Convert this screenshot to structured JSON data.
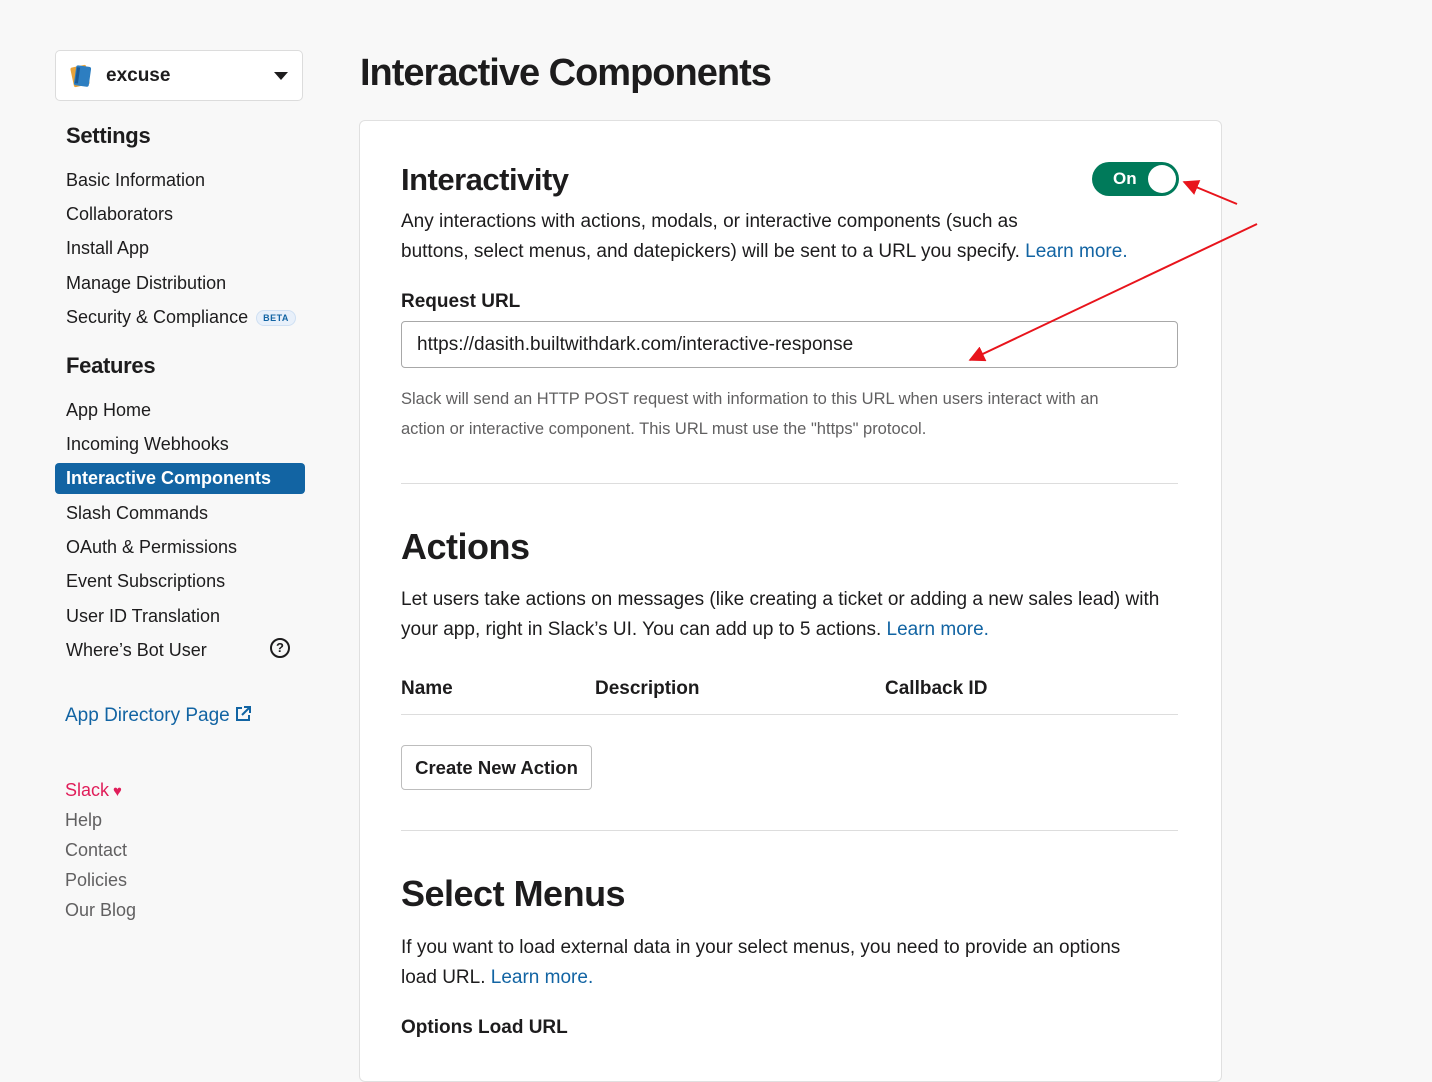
{
  "app": {
    "name": "excuse"
  },
  "sidebar": {
    "settings_heading": "Settings",
    "settings_items": [
      {
        "label": "Basic Information"
      },
      {
        "label": "Collaborators"
      },
      {
        "label": "Install App"
      },
      {
        "label": "Manage Distribution"
      },
      {
        "label": "Security & Compliance",
        "badge": "BETA"
      }
    ],
    "features_heading": "Features",
    "features_items": [
      {
        "label": "App Home"
      },
      {
        "label": "Incoming Webhooks"
      },
      {
        "label": "Interactive Components",
        "active": true
      },
      {
        "label": "Slash Commands"
      },
      {
        "label": "OAuth & Permissions"
      },
      {
        "label": "Event Subscriptions"
      },
      {
        "label": "User ID Translation"
      },
      {
        "label": "Where’s Bot User"
      }
    ],
    "help_glyph": "?",
    "app_directory_link": "App Directory Page",
    "footer": {
      "slack": "Slack",
      "heart": "♥",
      "help": "Help",
      "contact": "Contact",
      "policies": "Policies",
      "blog": "Our Blog"
    }
  },
  "main": {
    "title": "Interactive Components",
    "interactivity": {
      "title": "Interactivity",
      "toggle_label": "On",
      "toggle_on": true,
      "description_line1": "Any interactions with actions, modals, or interactive components (such as",
      "description_line2": "buttons, select menus, and datepickers) will be sent to a URL you specify.",
      "learn_more": "Learn more.",
      "request_url_label": "Request URL",
      "request_url_value": "https://dasith.builtwithdark.com/interactive-response",
      "hint_line1": "Slack will send an HTTP POST request with information to this URL when users interact with an",
      "hint_line2": "action or interactive component. This URL must use the \"https\" protocol."
    },
    "actions": {
      "title": "Actions",
      "description_line1": "Let users take actions on messages (like creating a ticket or adding a new sales lead) with",
      "description_line2": "your app, right in Slack’s UI. You can add up to 5 actions.",
      "learn_more": "Learn more.",
      "columns": [
        "Name",
        "Description",
        "Callback ID"
      ],
      "create_button": "Create New Action"
    },
    "select_menus": {
      "title": "Select Menus",
      "description_line1": "If you want to load external data in your select menus, you need to provide an options",
      "description_line2": "load URL.",
      "learn_more": "Learn more.",
      "options_label": "Options Load URL"
    }
  },
  "colors": {
    "accent": "#1264a3",
    "toggle_on": "#007a5a",
    "annotation_arrow": "#e8141c",
    "slack_pink": "#e01e5a"
  }
}
